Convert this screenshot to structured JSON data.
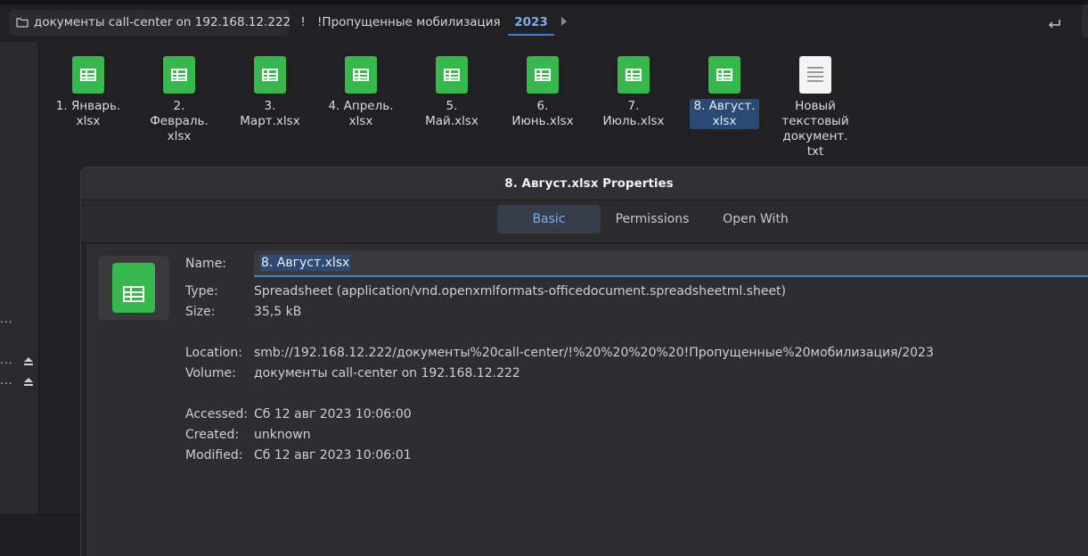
{
  "pathbar": {
    "root": "документы call-center on 192.168.12.222",
    "bang": "!",
    "missed": "!Пропущенные мобилизация",
    "year": "2023",
    "icons": [
      "folder-icon",
      "chevron-right-icon",
      "restore-icon"
    ]
  },
  "sidebar": {
    "items": [
      "...",
      "...",
      "..."
    ]
  },
  "files": [
    {
      "name": "1. Январь.\nxlsx",
      "icon": "spreadsheet-icon"
    },
    {
      "name": "2. Февраль.\nxlsx",
      "icon": "spreadsheet-icon"
    },
    {
      "name": "3. Март.xlsx",
      "icon": "spreadsheet-icon"
    },
    {
      "name": "4. Апрель.\nxlsx",
      "icon": "spreadsheet-icon"
    },
    {
      "name": "5. Май.xlsx",
      "icon": "spreadsheet-icon"
    },
    {
      "name": "6. Июнь.xlsx",
      "icon": "spreadsheet-icon"
    },
    {
      "name": "7. Июль.xlsx",
      "icon": "spreadsheet-icon"
    },
    {
      "name": "8. Август.\nxlsx",
      "icon": "spreadsheet-icon",
      "selected": true
    },
    {
      "name": "Новый\nтекстовый\nдокумент.\ntxt",
      "icon": "text-file-icon"
    }
  ],
  "dialog": {
    "title": "8. Август.xlsx Properties",
    "tabs": [
      "Basic",
      "Permissions",
      "Open With"
    ],
    "active_tab": "Basic",
    "labels": {
      "name": "Name:",
      "type": "Type:",
      "size": "Size:",
      "location": "Location:",
      "volume": "Volume:",
      "accessed": "Accessed:",
      "created": "Created:",
      "modified": "Modified:"
    },
    "values": {
      "name": "8. Август.xlsx",
      "type": "Spreadsheet (application/vnd.openxmlformats-officedocument.spreadsheetml.sheet)",
      "size": "35,5 kB",
      "location": "smb://192.168.12.222/документы%20call-center/!%20%20%20%20!Пропущенные%20мобилизация/2023",
      "volume": "документы call-center on 192.168.12.222",
      "accessed": "Сб 12 авг 2023 10:06:00",
      "created": "unknown",
      "modified": "Сб 12 авг 2023 10:06:01"
    }
  },
  "colors": {
    "accent": "#3584e4",
    "accent_text": "#78aeed",
    "spreadsheet": "#36b84d",
    "background": "#212123"
  }
}
